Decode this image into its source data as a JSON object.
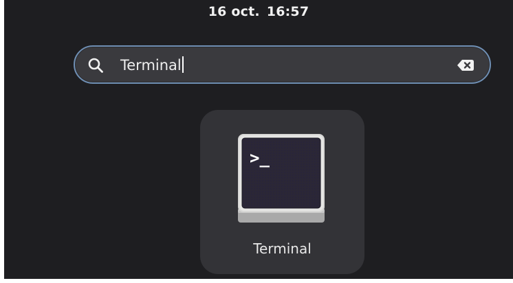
{
  "top_bar": {
    "date": "16 oct.",
    "time": "16:57"
  },
  "search": {
    "value": "Terminal",
    "icon": "search-icon",
    "clear_icon": "clear-icon"
  },
  "results": [
    {
      "label": "Terminal",
      "icon": "terminal-app-icon",
      "prompt_glyph": ">_"
    }
  ]
}
